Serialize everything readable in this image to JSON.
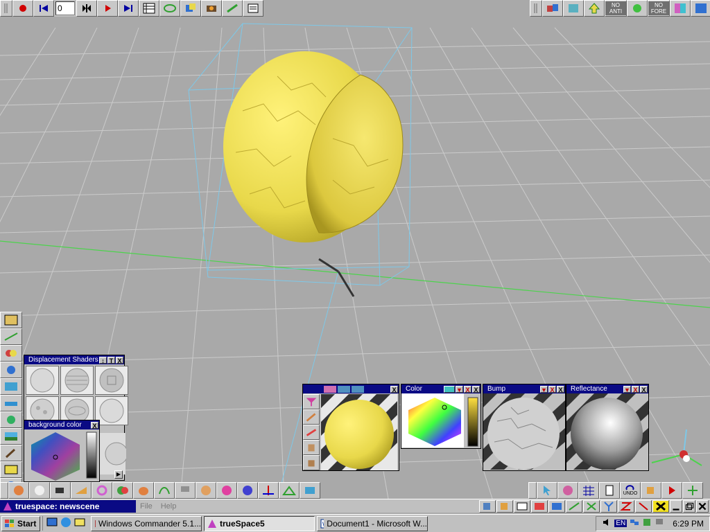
{
  "top_toolbar": {
    "frame_value": "0",
    "right_labels": {
      "no_anti": "NO ANTI",
      "no_fore": "NO FORE"
    }
  },
  "panels": {
    "displacement": {
      "title": "Displacement Shaders",
      "btn_t": "T",
      "btn_x": "X"
    },
    "background": {
      "title": "background color",
      "btn_x": "X"
    },
    "color": {
      "title": "Color",
      "btn_x": "X"
    },
    "bump": {
      "title": "Bump",
      "btn_x": "X"
    },
    "reflectance": {
      "title": "Reflectance",
      "btn_x": "X"
    }
  },
  "bottom_toolbar": {
    "undo_label": "UNDO"
  },
  "statusbar": {
    "app_title": "truespace: newscene",
    "menu": [
      "File",
      "Help"
    ]
  },
  "taskbar": {
    "start_label": "Start",
    "tasks": [
      "Windows Commander 5.1...",
      "trueSpace5",
      "Document1 - Microsoft W..."
    ],
    "active_task": "trueSpace5",
    "lang": "EN",
    "clock": "6:29 PM"
  },
  "colors": {
    "title_bar": "#0a0a84",
    "sphere": "#e8d84a",
    "grid": "#cfcfcf",
    "axis_green": "#4cd34c",
    "bbox": "#7ec8e8"
  }
}
